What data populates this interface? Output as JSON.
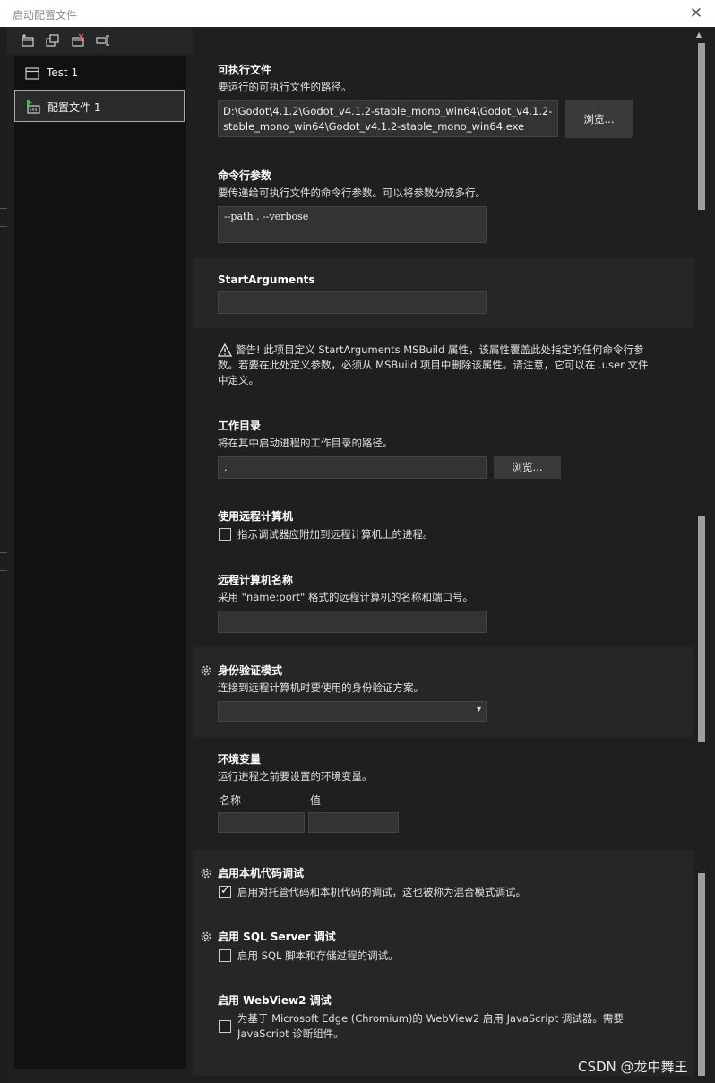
{
  "window": {
    "title": "启动配置文件",
    "close_glyph": "✕"
  },
  "sidebar": {
    "toolbar_icons": [
      "new-profile-icon",
      "copy-profile-icon",
      "delete-profile-icon",
      "rename-profile-icon"
    ],
    "items": [
      {
        "label": "Test 1",
        "icon": "window-icon",
        "selected": false
      },
      {
        "label": "配置文件 1",
        "icon": "profile-run-icon",
        "selected": true
      }
    ]
  },
  "executable": {
    "title": "可执行文件",
    "description": "要运行的可执行文件的路径。",
    "path_line1": "D:\\Godot\\4.1.2\\Godot_v4.1.2-stable_mono_win64\\Godot_v4.1.2-",
    "path_line2": "stable_mono_win64\\Godot_v4.1.2-stable_mono_win64.exe",
    "browse_label": "浏览..."
  },
  "command_args": {
    "title": "命令行参数",
    "description": "要传递给可执行文件的命令行参数。可以将参数分成多行。",
    "value": "--path . --verbose"
  },
  "start_arguments": {
    "title": "StartArguments",
    "value": ""
  },
  "warning": {
    "icon": "warning-icon",
    "line1": "警告! 此项目定义 StartArguments MSBuild 属性，该属性覆盖此处指定的任何命令行参",
    "line2": "数。若要在此处定义参数，必须从 MSBuild 项目中删除该属性。请注意，它可以在 .user 文件",
    "line3": "中定义。"
  },
  "working_dir": {
    "title": "工作目录",
    "description": "将在其中启动进程的工作目录的路径。",
    "value": ".",
    "browse_label": "浏览..."
  },
  "remote": {
    "title": "使用远程计算机",
    "checkbox_label": "指示调试器应附加到远程计算机上的进程。",
    "checked": false
  },
  "remote_name": {
    "title": "远程计算机名称",
    "description": "采用 \"name:port\" 格式的远程计算机的名称和端口号。",
    "value": ""
  },
  "auth": {
    "title": "身份验证模式",
    "description": "连接到远程计算机时要使用的身份验证方案。",
    "selected": "",
    "dropdown_glyph": "▾"
  },
  "env": {
    "title": "环境变量",
    "description": "运行进程之前要设置的环境变量。",
    "col_name": "名称",
    "col_value": "值"
  },
  "native": {
    "title": "启用本机代码调试",
    "checkbox_label": "启用对托管代码和本机代码的调试，这也被称为混合模式调试。",
    "checked": true,
    "check_glyph": "✓"
  },
  "sql": {
    "title": "启用 SQL Server 调试",
    "checkbox_label": "启用 SQL 脚本和存储过程的调试。",
    "checked": false
  },
  "webview": {
    "title": "启用 WebView2 调试",
    "line1": "为基于 Microsoft Edge (Chromium)的 WebView2 启用 JavaScript 调试器。需要",
    "line2": "JavaScript 诊断组件。",
    "checked": false
  },
  "watermark": "CSDN @龙中舞王",
  "scrollbar": {
    "up_glyph": "▲"
  }
}
